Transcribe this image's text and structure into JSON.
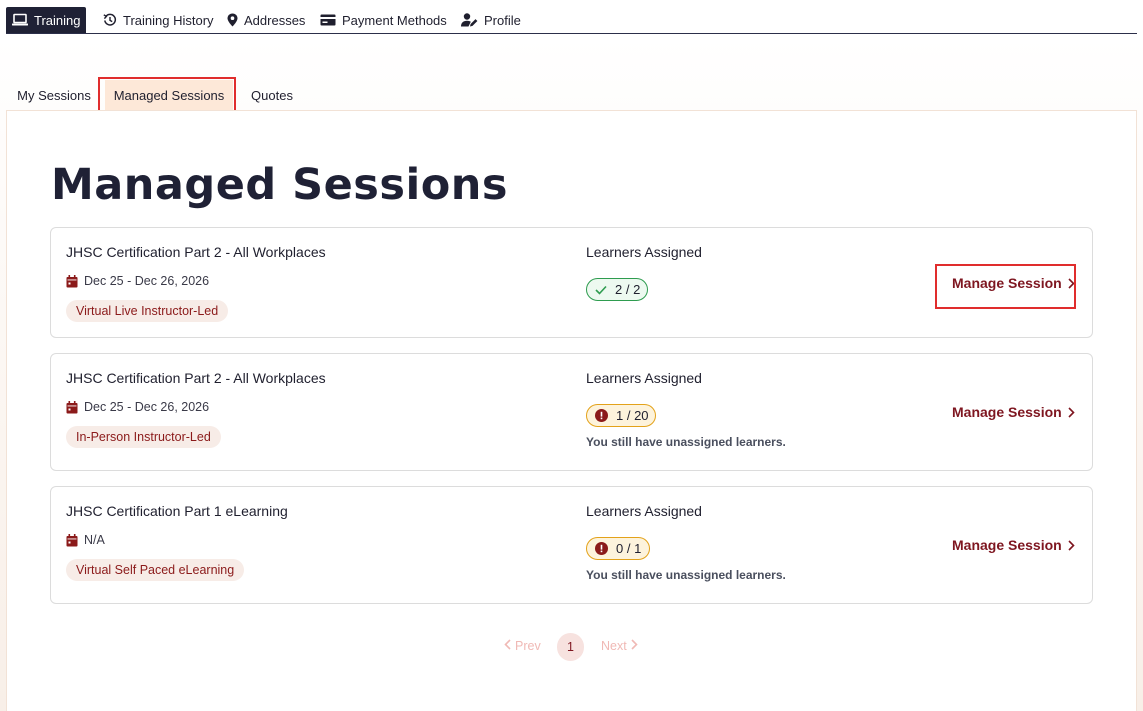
{
  "topnav": {
    "items": [
      {
        "label": "Training",
        "icon": "laptop-icon",
        "active": true
      },
      {
        "label": "Training History",
        "icon": "history-icon"
      },
      {
        "label": "Addresses",
        "icon": "map-pin-icon"
      },
      {
        "label": "Payment Methods",
        "icon": "credit-card-icon"
      },
      {
        "label": "Profile",
        "icon": "user-edit-icon"
      }
    ]
  },
  "subtabs": {
    "items": [
      {
        "label": "My Sessions"
      },
      {
        "label": "Managed Sessions",
        "active": true
      },
      {
        "label": "Quotes"
      }
    ]
  },
  "page": {
    "title": "Managed Sessions"
  },
  "sessions": [
    {
      "title": "JHSC Certification Part 2 - All Workplaces",
      "date": "Dec 25 - Dec 26, 2026",
      "delivery": "Virtual Live Instructor-Led",
      "learners_label": "Learners Assigned",
      "learners": "2 / 2",
      "status": "complete",
      "note": "",
      "action": "Manage Session"
    },
    {
      "title": "JHSC Certification Part 2 - All Workplaces",
      "date": "Dec 25 - Dec 26, 2026",
      "delivery": "In-Person Instructor-Led",
      "learners_label": "Learners Assigned",
      "learners": "1 / 20",
      "status": "incomplete",
      "note": "You still have unassigned learners.",
      "action": "Manage Session"
    },
    {
      "title": "JHSC Certification Part 1 eLearning",
      "date": "N/A",
      "delivery": "Virtual Self Paced eLearning",
      "learners_label": "Learners Assigned",
      "learners": "0 / 1",
      "status": "incomplete",
      "note": "You still have unassigned learners.",
      "action": "Manage Session"
    }
  ],
  "pagination": {
    "prev": "Prev",
    "current": "1",
    "next": "Next"
  },
  "colors": {
    "nav_active_bg": "#1f2135",
    "accent": "#7e1620",
    "tab_active_bg": "#fde8d8",
    "tag_bg": "#f7ece7",
    "ok_border": "#2e9c4f",
    "warn_border": "#e3a21a",
    "highlight": "#e02d2d"
  }
}
